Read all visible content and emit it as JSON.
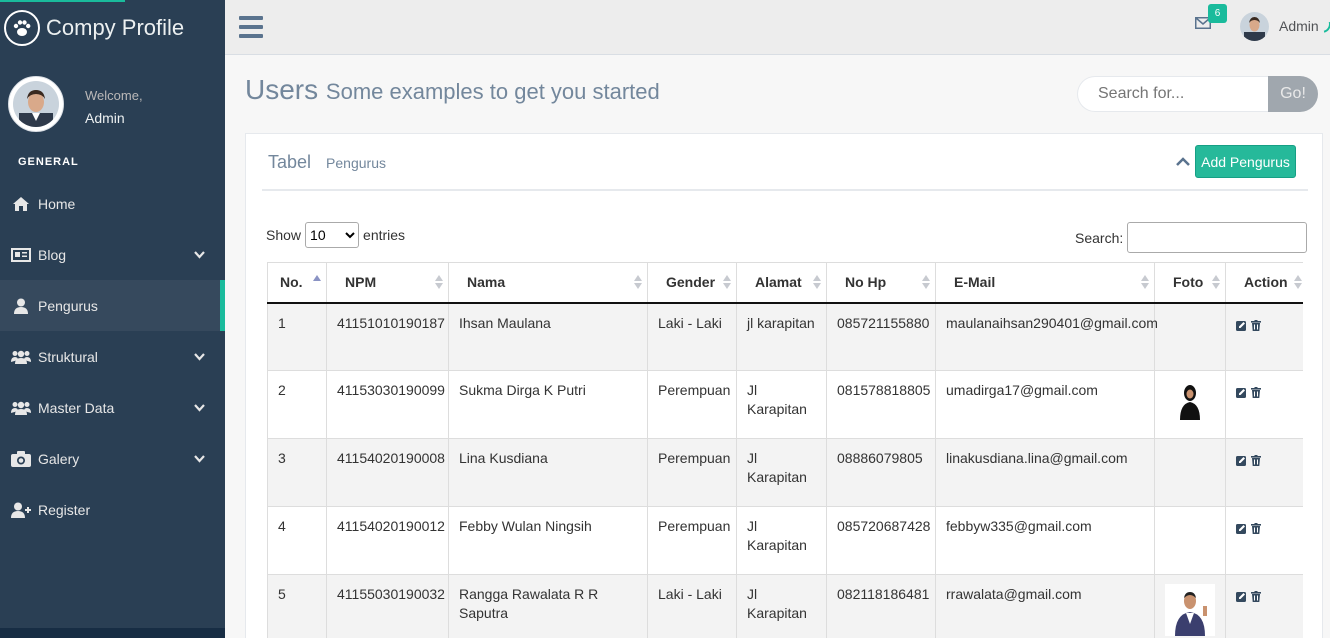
{
  "app": {
    "title": "Compy Profile"
  },
  "profile": {
    "welcome": "Welcome,",
    "name": "Admin"
  },
  "sidebar": {
    "section": "GENERAL",
    "items": [
      {
        "label": "Home",
        "icon": "home-icon",
        "has_children": false,
        "active": false
      },
      {
        "label": "Blog",
        "icon": "newspaper-icon",
        "has_children": true,
        "active": false
      },
      {
        "label": "Pengurus",
        "icon": "user-icon",
        "has_children": false,
        "active": true
      },
      {
        "label": "Struktural",
        "icon": "users-icon",
        "has_children": true,
        "active": false
      },
      {
        "label": "Master Data",
        "icon": "users-icon",
        "has_children": true,
        "active": false
      },
      {
        "label": "Galery",
        "icon": "camera-icon",
        "has_children": true,
        "active": false
      },
      {
        "label": "Register",
        "icon": "user-plus-icon",
        "has_children": false,
        "active": false
      }
    ]
  },
  "topnav": {
    "mail_count": "6",
    "user_name": "Admin"
  },
  "page": {
    "title": "Users",
    "subtitle": "Some examples to get you started"
  },
  "search": {
    "placeholder": "Search for...",
    "button": "Go!"
  },
  "panel": {
    "title": "Tabel",
    "subtitle": "Pengurus",
    "add_button": "Add Pengurus",
    "show_label": "Show",
    "entries_value": "10",
    "entries_label": "entries",
    "search_label": "Search:"
  },
  "table": {
    "columns": [
      "No.",
      "NPM",
      "Nama",
      "Gender",
      "Alamat",
      "No Hp",
      "E-Mail",
      "Foto",
      "Action"
    ],
    "rows": [
      {
        "no": "1",
        "npm": "41151010190187",
        "nama": "Ihsan Maulana",
        "gender": "Laki - Laki",
        "alamat": "jl karapitan",
        "hp": "085721155880",
        "email": "maulanaihsan290401@gmail.com",
        "foto": ""
      },
      {
        "no": "2",
        "npm": "41153030190099",
        "nama": "Sukma Dirga K Putri",
        "gender": "Perempuan",
        "alamat": "Jl Karapitan",
        "hp": "081578818805",
        "email": "umadirga17@gmail.com",
        "foto": "photo-woman"
      },
      {
        "no": "3",
        "npm": "41154020190008",
        "nama": "Lina Kusdiana",
        "gender": "Perempuan",
        "alamat": "Jl Karapitan",
        "hp": "08886079805",
        "email": "linakusdiana.lina@gmail.com",
        "foto": ""
      },
      {
        "no": "4",
        "npm": "41154020190012",
        "nama": "Febby Wulan Ningsih",
        "gender": "Perempuan",
        "alamat": "Jl Karapitan",
        "hp": "085720687428",
        "email": "febbyw335@gmail.com",
        "foto": ""
      },
      {
        "no": "5",
        "npm": "41155030190032",
        "nama": "Rangga Rawalata R R Saputra",
        "gender": "Laki - Laki",
        "alamat": "Jl Karapitan",
        "hp": "082118186481",
        "email": "rrawalata@gmail.com",
        "foto": "photo-man"
      }
    ]
  },
  "colors": {
    "sidebar": "#2a3f54",
    "accent": "#1abb9c",
    "button": "#26b99a"
  }
}
